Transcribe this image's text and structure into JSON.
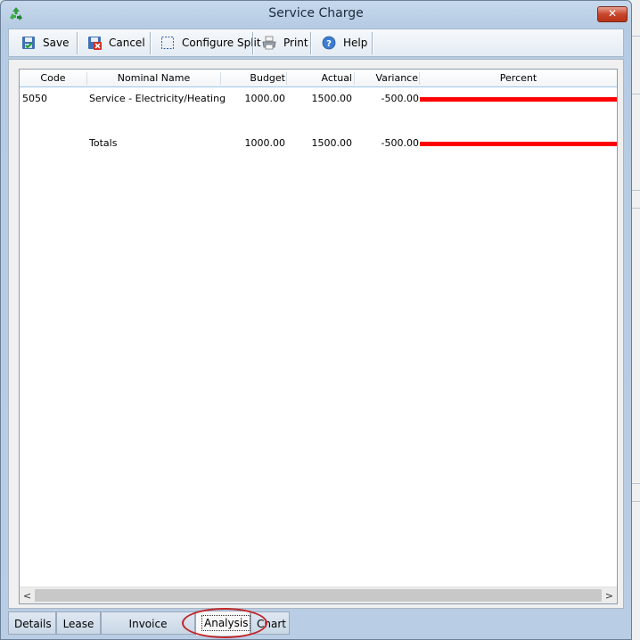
{
  "window": {
    "title": "Service Charge",
    "close_label": "✕"
  },
  "icons": {
    "app": "recycle-app-icon",
    "save": "save-icon",
    "cancel": "cancel-icon",
    "configure_split": "dashed-rectangle-icon",
    "print": "printer-icon",
    "help": "help-icon"
  },
  "toolbar": {
    "save_label": "Save",
    "cancel_label": "Cancel",
    "configure_split_label": "Configure Split",
    "print_label": "Print",
    "help_label": "Help"
  },
  "grid": {
    "columns": [
      "Code",
      "Nominal Name",
      "Budget",
      "Actual",
      "Variance",
      "Percent"
    ],
    "rows": [
      {
        "code": "5050",
        "nominal_name": "Service - Electricity/Heating",
        "budget": "1000.00",
        "actual": "1500.00",
        "variance": "-500.00",
        "percent_fill": 1.0
      }
    ],
    "totals": {
      "label": "Totals",
      "budget": "1000.00",
      "actual": "1500.00",
      "variance": "-500.00",
      "percent_fill": 1.0
    }
  },
  "scrollbar": {
    "left_arrow": "<",
    "right_arrow": ">"
  },
  "tabs": [
    {
      "label": "Details"
    },
    {
      "label": "Lease"
    },
    {
      "label": "Invoice Schedule"
    },
    {
      "label": "Analysis",
      "active": true
    },
    {
      "label": "Chart"
    }
  ],
  "colors": {
    "bar": "#ff0000",
    "highlight_ring": "#c0262a",
    "close_button": "#c7452b"
  }
}
